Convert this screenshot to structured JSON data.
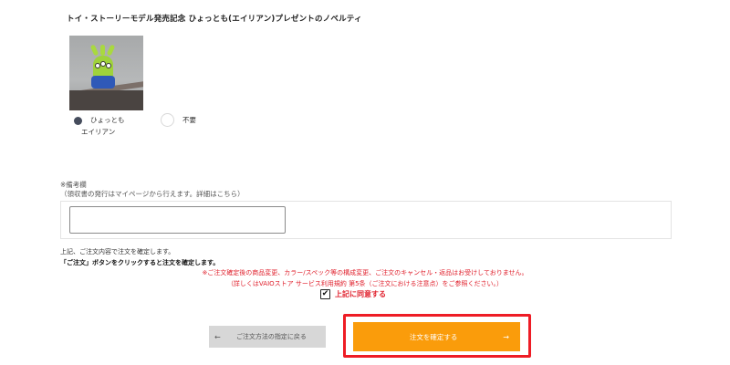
{
  "novelty": {
    "title": "トイ・ストーリーモデル発売記念 ひょっとも(エイリアン)プレゼントのノベルティ",
    "options": [
      {
        "label": "ひょっとも\nエイリアン",
        "selected": true
      },
      {
        "label": "不要",
        "selected": false
      }
    ]
  },
  "remarks": {
    "label_line1": "※備考欄",
    "label_line2": "（領収書の発行はマイページから行えます。詳細はこちら）",
    "value": ""
  },
  "confirm": {
    "line1": "上記、ご注文内容で注文を確定します。",
    "line2": "「ご注文」ボタンをクリックすると注文を確定します。",
    "warning1": "※ご注文確定後の商品変更、カラー/スペック等の構成変更、ご注文のキャンセル・返品はお受けしておりません。",
    "warning2": "（詳しくはVAIOストア サービス利用規約 第5条（ご注文における注意点）をご参照ください。）",
    "agree_label": "上記に同意する",
    "agree_checked": true
  },
  "buttons": {
    "back_arrow": "←",
    "back_label": "ご注文方法の指定に戻る",
    "submit_label": "注文を確定する",
    "submit_arrow": "→"
  },
  "colors": {
    "accent": "#fa9c0b",
    "highlight": "#ee1c25",
    "warning": "#e0212d"
  }
}
